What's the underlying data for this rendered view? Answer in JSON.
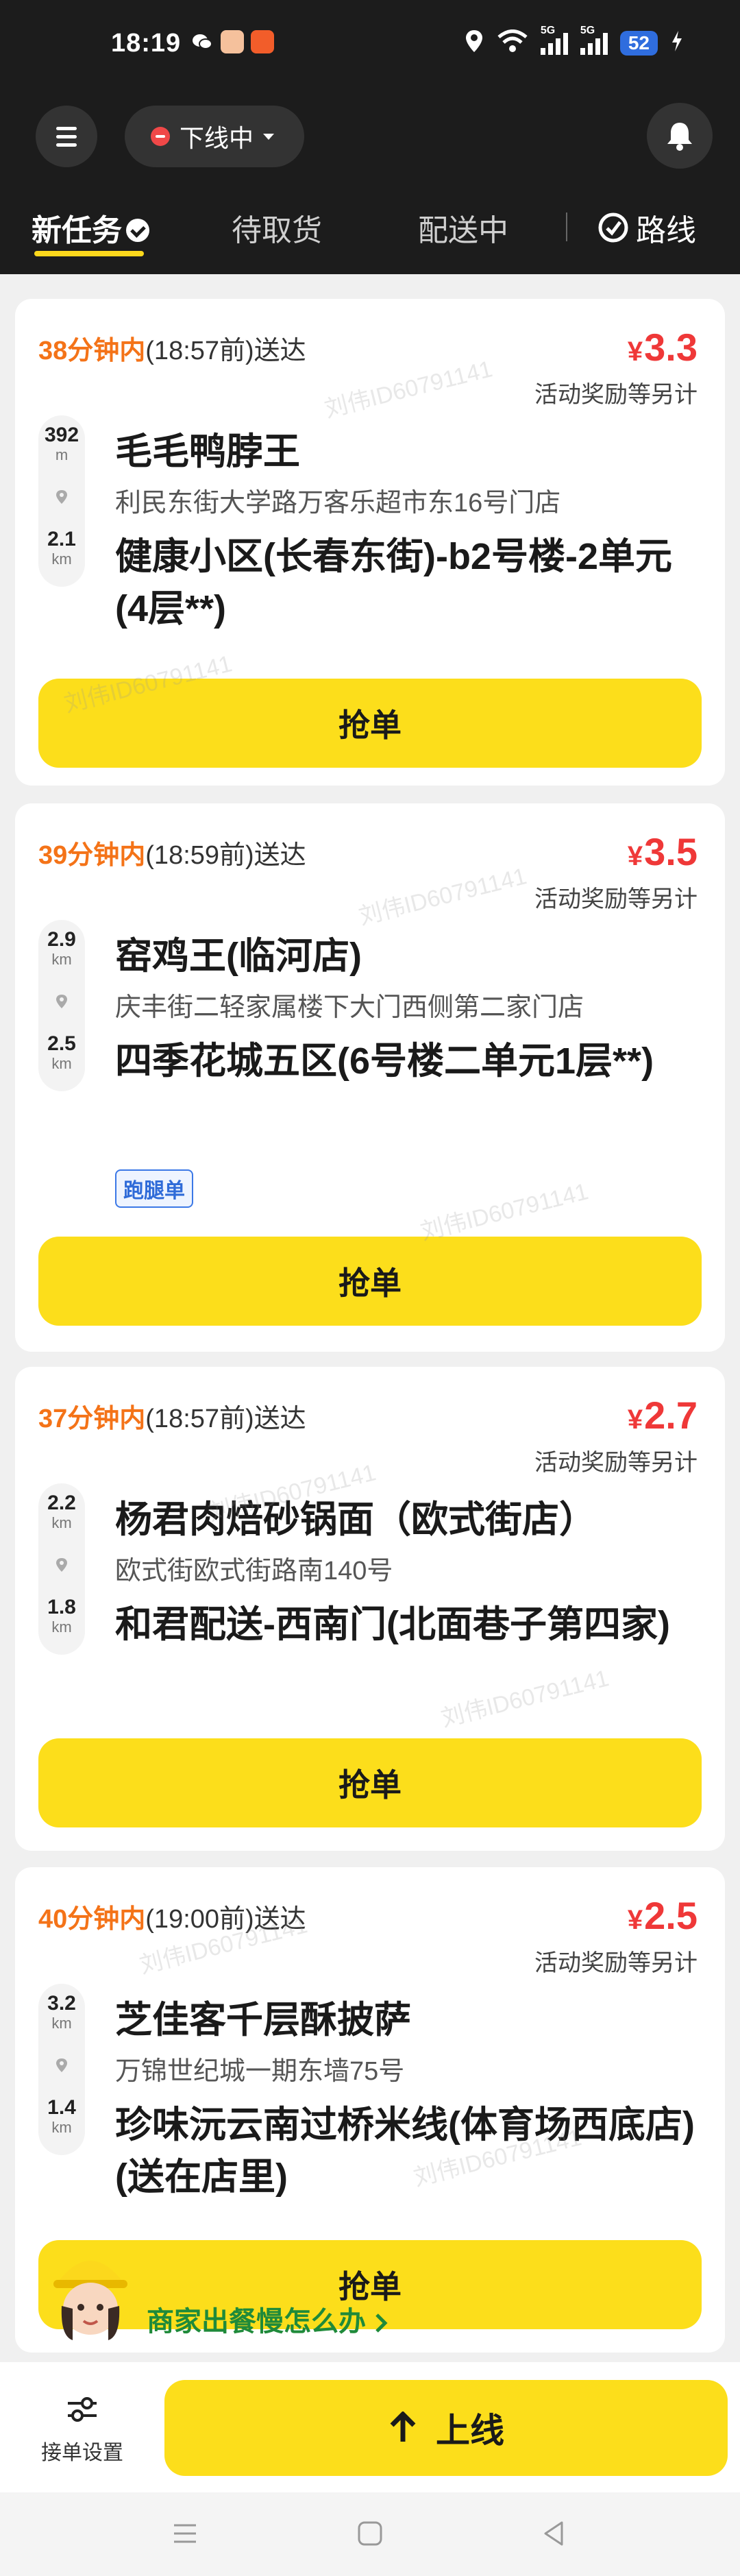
{
  "status_bar": {
    "time": "18:19",
    "network_labels": [
      "5G",
      "5G"
    ],
    "battery": "52"
  },
  "header": {
    "online_status": "下线中",
    "tabs": [
      {
        "label": "新任务",
        "active": true
      },
      {
        "label": "待取货",
        "active": false
      },
      {
        "label": "配送中",
        "active": false
      }
    ],
    "route_label": "路线"
  },
  "orders": [
    {
      "deadline_minutes": "38分钟内",
      "deadline_time": "(18:57前)送达",
      "price_currency": "¥",
      "price": "3.3",
      "bonus_note": "活动奖励等另计",
      "pickup_distance": {
        "value": "392",
        "unit": "m"
      },
      "delivery_distance": {
        "value": "2.1",
        "unit": "km"
      },
      "store_name": "毛毛鸭脖王",
      "store_address": "利民东街大学路万客乐超市东16号门店",
      "destination": "健康小区(长春东街)-b2号楼-2单元(4层**)",
      "tag": "",
      "action_label": "抢单"
    },
    {
      "deadline_minutes": "39分钟内",
      "deadline_time": "(18:59前)送达",
      "price_currency": "¥",
      "price": "3.5",
      "bonus_note": "活动奖励等另计",
      "pickup_distance": {
        "value": "2.9",
        "unit": "km"
      },
      "delivery_distance": {
        "value": "2.5",
        "unit": "km"
      },
      "store_name": "窑鸡王(临河店)",
      "store_address": "庆丰街二轻家属楼下大门西侧第二家门店",
      "destination": "四季花城五区(6号楼二单元1层**)",
      "tag": "跑腿单",
      "action_label": "抢单"
    },
    {
      "deadline_minutes": "37分钟内",
      "deadline_time": "(18:57前)送达",
      "price_currency": "¥",
      "price": "2.7",
      "bonus_note": "活动奖励等另计",
      "pickup_distance": {
        "value": "2.2",
        "unit": "km"
      },
      "delivery_distance": {
        "value": "1.8",
        "unit": "km"
      },
      "store_name": "杨君肉焙砂锅面（欧式街店）",
      "store_address": "欧式街欧式街路南140号",
      "destination": "和君配送-西南门(北面巷子第四家)",
      "tag": "",
      "action_label": "抢单"
    },
    {
      "deadline_minutes": "40分钟内",
      "deadline_time": "(19:00前)送达",
      "price_currency": "¥",
      "price": "2.5",
      "bonus_note": "活动奖励等另计",
      "pickup_distance": {
        "value": "3.2",
        "unit": "km"
      },
      "delivery_distance": {
        "value": "1.4",
        "unit": "km"
      },
      "store_name": "芝佳客千层酥披萨",
      "store_address": "万锦世纪城一期东墙75号",
      "destination": "珍味沅云南过桥米线(体育场西底店)(送在店里)",
      "tag": "",
      "action_label": "抢单"
    }
  ],
  "help_banner": {
    "text": "商家出餐慢怎么办"
  },
  "bottom_bar": {
    "settings_label": "接单设置",
    "online_label": "上线"
  },
  "watermark": "刘伟ID60791141",
  "colors": {
    "accent_yellow": "#fcde1b",
    "deadline_orange": "#f47318",
    "price_red": "#ef3838",
    "header_dark": "#1c1c1c"
  }
}
